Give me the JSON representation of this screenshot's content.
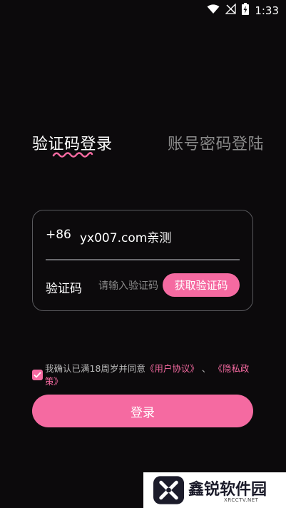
{
  "status_bar": {
    "time": "1:33",
    "icons": [
      "wifi-icon",
      "signal-off-icon",
      "battery-charging-icon"
    ]
  },
  "tabs": [
    {
      "label": "验证码登录",
      "active": true
    },
    {
      "label": "账号密码登陆",
      "active": false
    }
  ],
  "form": {
    "country_code": "+86",
    "phone_value": "yx007.com亲测",
    "code_label": "验证码",
    "code_placeholder": "请输入验证码",
    "get_code_label": "获取验证码"
  },
  "agreement": {
    "checked": true,
    "prefix": "我确认已满18周岁并同意",
    "user_agreement": "《用户协议》",
    "separator": "、",
    "privacy_policy": "《隐私政策》"
  },
  "login_label": "登录",
  "watermark": {
    "title": "鑫锐软件园",
    "subtitle": "XRCCTV.NET"
  },
  "colors": {
    "background": "#0c0a0c",
    "accent": "#f56aa1",
    "muted_text": "#8a8a8a"
  }
}
